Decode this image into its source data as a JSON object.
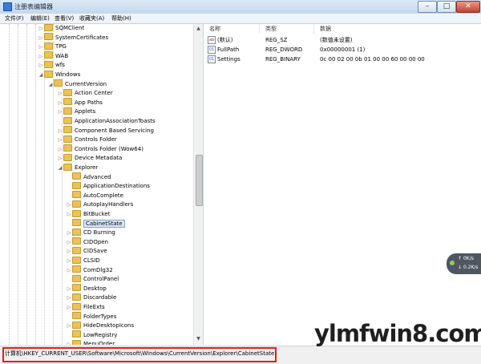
{
  "window": {
    "title": "注册表编辑器",
    "buttons": {
      "minimize": "–",
      "maximize": "□",
      "close": "✕"
    }
  },
  "menu": [
    "文件(F)",
    "编辑(E)",
    "查看(V)",
    "收藏夹(A)",
    "帮助(H)"
  ],
  "tree": [
    {
      "label": "SQMClient",
      "level": 4,
      "arrow": "right"
    },
    {
      "label": "SystemCertificates",
      "level": 4,
      "arrow": "right"
    },
    {
      "label": "TPG",
      "level": 4,
      "arrow": "right"
    },
    {
      "label": "WAB",
      "level": 4,
      "arrow": "right"
    },
    {
      "label": "wfs",
      "level": 4,
      "arrow": "right"
    },
    {
      "label": "Windows",
      "level": 4,
      "arrow": "down"
    },
    {
      "label": "CurrentVersion",
      "level": 5,
      "arrow": "down"
    },
    {
      "label": "Action Center",
      "level": 6,
      "arrow": "right"
    },
    {
      "label": "App Paths",
      "level": 6,
      "arrow": "right"
    },
    {
      "label": "Applets",
      "level": 6,
      "arrow": "right"
    },
    {
      "label": "ApplicationAssociationToasts",
      "level": 6,
      "arrow": ""
    },
    {
      "label": "Component Based Servicing",
      "level": 6,
      "arrow": "right"
    },
    {
      "label": "Controls Folder",
      "level": 6,
      "arrow": "right"
    },
    {
      "label": "Controls Folder (Wow64)",
      "level": 6,
      "arrow": "right"
    },
    {
      "label": "Device Metadata",
      "level": 6,
      "arrow": "right"
    },
    {
      "label": "Explorer",
      "level": 6,
      "arrow": "down"
    },
    {
      "label": "Advanced",
      "level": 7,
      "arrow": ""
    },
    {
      "label": "ApplicationDestinations",
      "level": 7,
      "arrow": ""
    },
    {
      "label": "AutoComplete",
      "level": 7,
      "arrow": ""
    },
    {
      "label": "AutoplayHandlers",
      "level": 7,
      "arrow": "right"
    },
    {
      "label": "BitBucket",
      "level": 7,
      "arrow": "right"
    },
    {
      "label": "CabinetState",
      "level": 7,
      "arrow": "",
      "selected": true
    },
    {
      "label": "CD Burning",
      "level": 7,
      "arrow": "right"
    },
    {
      "label": "CIDOpen",
      "level": 7,
      "arrow": "right"
    },
    {
      "label": "CIDSave",
      "level": 7,
      "arrow": "right"
    },
    {
      "label": "CLSID",
      "level": 7,
      "arrow": "right"
    },
    {
      "label": "ComDlg32",
      "level": 7,
      "arrow": "right"
    },
    {
      "label": "ControlPanel",
      "level": 7,
      "arrow": ""
    },
    {
      "label": "Desktop",
      "level": 7,
      "arrow": "right"
    },
    {
      "label": "Discardable",
      "level": 7,
      "arrow": "right"
    },
    {
      "label": "FileExts",
      "level": 7,
      "arrow": "right"
    },
    {
      "label": "FolderTypes",
      "level": 7,
      "arrow": ""
    },
    {
      "label": "HideDesktopIcons",
      "level": 7,
      "arrow": "right"
    },
    {
      "label": "LowRegistry",
      "level": 7,
      "arrow": ""
    },
    {
      "label": "MenuOrder",
      "level": 7,
      "arrow": "right"
    }
  ],
  "list": {
    "columns": [
      "名称",
      "类型",
      "数据"
    ],
    "rows": [
      {
        "icon": "ab",
        "name": "(默认)",
        "type": "REG_SZ",
        "data": "(数值未设置)"
      },
      {
        "icon": "bin",
        "name": "FullPath",
        "type": "REG_DWORD",
        "data": "0x00000001 (1)"
      },
      {
        "icon": "bin",
        "name": "Settings",
        "type": "REG_BINARY",
        "data": "0c 00 02 00 0b 01 00 00 60 00 00 00"
      }
    ]
  },
  "status": {
    "path": "计算机\\HKEY_CURRENT_USER\\Software\\Microsoft\\Windows\\CurrentVersion\\Explorer\\CabinetState"
  },
  "netwidget": {
    "up": "0K/s",
    "down": "0.2K/s"
  },
  "watermark": "ylmfwin8.com"
}
